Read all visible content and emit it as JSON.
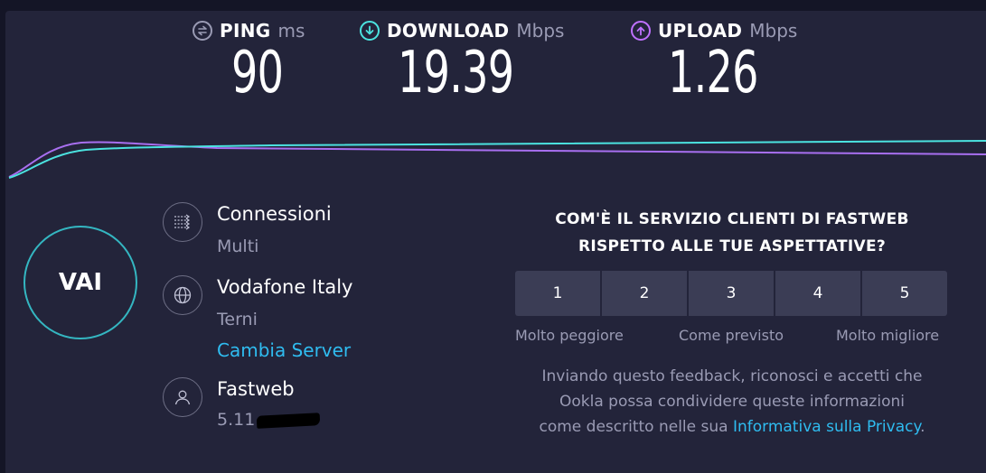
{
  "metrics": {
    "ping": {
      "label": "PING",
      "unit": "ms",
      "value": "90",
      "icon": "ping-icon",
      "color": "#9a9bb4"
    },
    "download": {
      "label": "DOWNLOAD",
      "unit": "Mbps",
      "value": "19.39",
      "icon": "download-arrow-icon",
      "color": "#4be3e0"
    },
    "upload": {
      "label": "UPLOAD",
      "unit": "Mbps",
      "value": "1.26",
      "icon": "upload-arrow-icon",
      "color": "#bf71ff"
    }
  },
  "graph_colors": {
    "download": "#4be3e0",
    "upload": "#a86ff0"
  },
  "go_button": {
    "label": "VAI",
    "ring_color": "#34b6c1"
  },
  "connections": {
    "title": "Connessioni",
    "value": "Multi",
    "icon": "connections-icon"
  },
  "server": {
    "name": "Vodafone Italy",
    "location": "Terni",
    "change_link": "Cambia Server",
    "icon": "globe-icon"
  },
  "provider": {
    "name": "Fastweb",
    "ip_visible": "5.11",
    "ip_redacted": true,
    "icon": "user-icon"
  },
  "survey": {
    "question_line1": "COM'È IL SERVIZIO CLIENTI DI FASTWEB",
    "question_line2": "RISPETTO ALLE TUE ASPETTATIVE?",
    "ratings": [
      "1",
      "2",
      "3",
      "4",
      "5"
    ],
    "scale_low": "Molto peggiore",
    "scale_mid": "Come previsto",
    "scale_high": "Molto migliore",
    "disclaimer_line1": "Inviando questo feedback, riconosci e accetti che",
    "disclaimer_line2": "Ookla possa condividere queste informazioni",
    "disclaimer_line3_prefix": "come descritto nelle sua",
    "privacy_link": "Informativa sulla Privacy",
    "disclaimer_suffix": "."
  },
  "accent_link_color": "#2fbcf0"
}
